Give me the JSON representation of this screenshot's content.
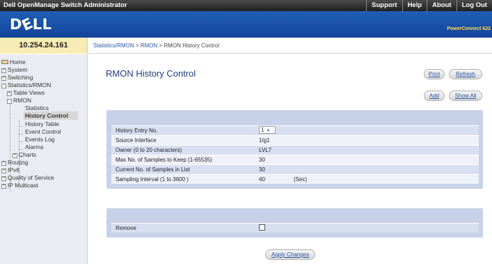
{
  "topbar": {
    "title": "Dell OpenManage Switch Administrator",
    "links": [
      "Support",
      "Help",
      "About",
      "Log Out"
    ]
  },
  "banner": {
    "logo": "DELL",
    "product": "PowerConnect 622"
  },
  "status": {
    "ip": "10.254.24.161",
    "breadcrumb": [
      "Statistics/RMON",
      "RMON",
      "RMON History Control"
    ],
    "separator": ">"
  },
  "sidebar": {
    "items": [
      {
        "label": "Home"
      },
      {
        "label": "System",
        "expander": "+"
      },
      {
        "label": "Switching",
        "expander": "+"
      },
      {
        "label": "Statistics/RMON",
        "expander": "-"
      },
      {
        "label": "Table Views",
        "expander": "+"
      },
      {
        "label": "RMON",
        "expander": "-"
      },
      {
        "label": "Statistics"
      },
      {
        "label": "History Control"
      },
      {
        "label": "History Table"
      },
      {
        "label": "Event Control"
      },
      {
        "label": "Events Log"
      },
      {
        "label": "Alarms"
      },
      {
        "label": "Charts",
        "expander": "+"
      },
      {
        "label": "Routing",
        "expander": "+"
      },
      {
        "label": "IPv6",
        "expander": "+"
      },
      {
        "label": "Quality of Service",
        "expander": "+"
      },
      {
        "label": "IP Multicast",
        "expander": "+"
      }
    ]
  },
  "main": {
    "title": "RMON History Control",
    "buttons": {
      "print": "Print",
      "refresh": "Refresh",
      "add": "Add",
      "show_all": "Show All",
      "apply": "Apply Changes"
    },
    "fields": [
      {
        "label": "History Entry No.",
        "value": "1"
      },
      {
        "label": "Source Interface",
        "value": "1/g1"
      },
      {
        "label": "Owner (0 to 20 characters)",
        "value": "LVL7"
      },
      {
        "label": "Max No. of Samples to Keep (1-65535)",
        "value": "30"
      },
      {
        "label": "Current No. of Samples in List",
        "value": "30"
      },
      {
        "label": "Sampling Interval (1 to 3600 )",
        "value": "40",
        "unit": "(Sec)"
      }
    ],
    "remove": {
      "label": "Remove",
      "checked": false
    }
  }
}
